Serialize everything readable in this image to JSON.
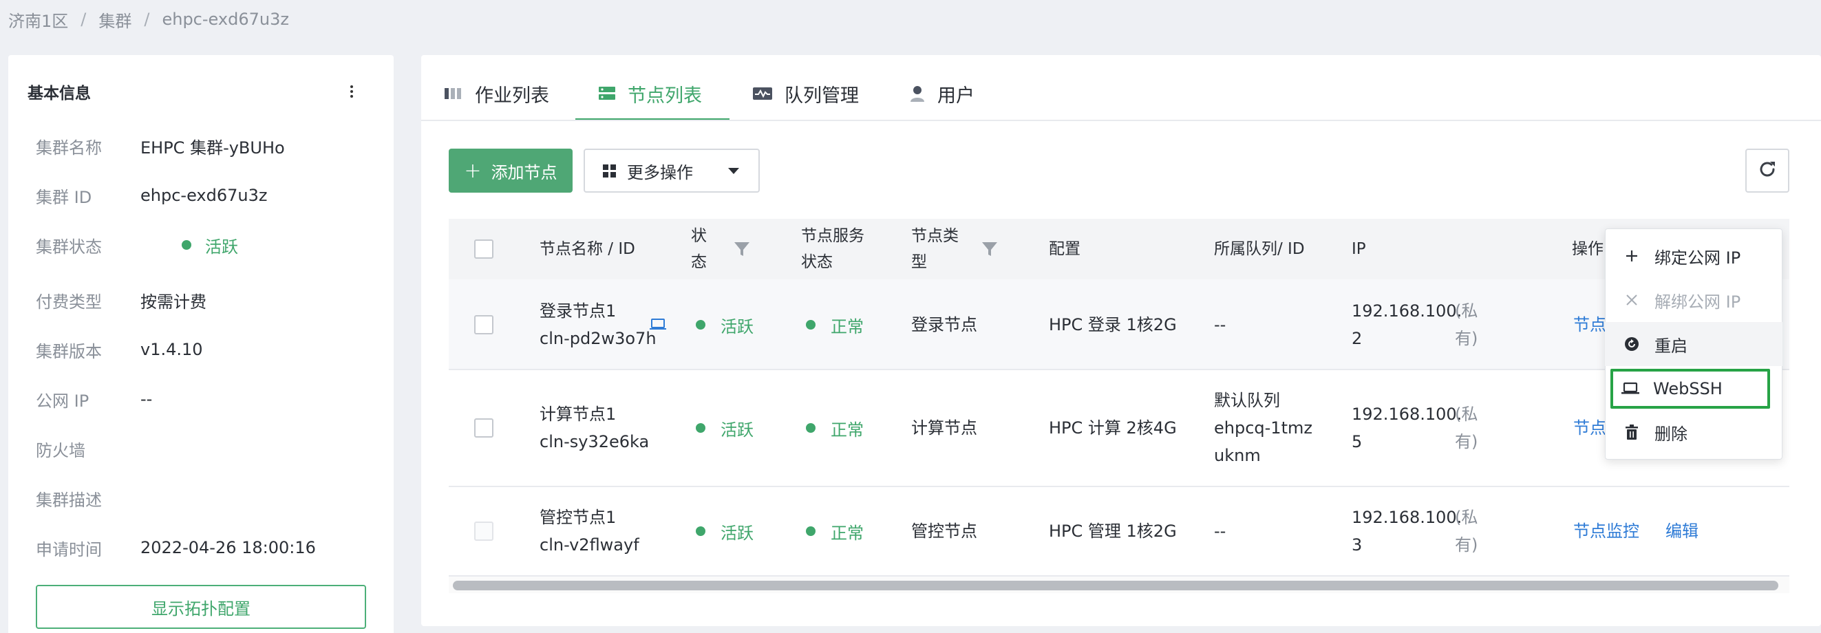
{
  "breadcrumb": [
    "济南1区",
    "集群",
    "ehpc-exd67u3z"
  ],
  "left_panel": {
    "title": "基本信息",
    "rows": [
      {
        "label": "集群名称",
        "value": "EHPC 集群-yBUHo"
      },
      {
        "label": "集群 ID",
        "value": "ehpc-exd67u3z"
      },
      {
        "label": "集群状态",
        "value": "活跃"
      },
      {
        "label": "付费类型",
        "value": "按需计费"
      },
      {
        "label": "集群版本",
        "value": "v1.4.10"
      },
      {
        "label": "公网 IP",
        "value": "--"
      },
      {
        "label": "防火墙",
        "value": ""
      },
      {
        "label": "集群描述",
        "value": ""
      },
      {
        "label": "申请时间",
        "value": "2022-04-26 18:00:16"
      }
    ],
    "topology_button": "显示拓扑配置"
  },
  "tabs": [
    {
      "label": "作业列表",
      "icon": "bars-icon"
    },
    {
      "label": "节点列表",
      "icon": "server-icon"
    },
    {
      "label": "队列管理",
      "icon": "activity-icon"
    },
    {
      "label": "用户",
      "icon": "user-icon"
    }
  ],
  "active_tab": "节点列表",
  "toolbar": {
    "add_label": "添加节点",
    "more_label": "更多操作"
  },
  "table": {
    "headers": {
      "name": "节点名称 / ID",
      "status_1": "状",
      "status_2": "态",
      "service_1": "节点服务",
      "service_2": "状态",
      "type_1": "节点类",
      "type_2": "型",
      "config": "配置",
      "queue": "所属队列/ ID",
      "ip": "IP",
      "ops": "操作"
    },
    "rows": [
      {
        "name": "登录节点1",
        "id": "cln-pd2w3o7h",
        "status": "活跃",
        "service": "正常",
        "type": "登录节点",
        "config": "HPC 登录 1核2G",
        "queue_1": "--",
        "queue_2": "",
        "queue_3": "",
        "ip_1": "192.168.100.",
        "ip_2": "2",
        "ip_tag_1": "(私",
        "ip_tag_2": "有)",
        "op_1": "节点监控"
      },
      {
        "name": "计算节点1",
        "id": "cln-sy32e6ka",
        "status": "活跃",
        "service": "正常",
        "type": "计算节点",
        "config": "HPC 计算 2核4G",
        "queue_1": "默认队列",
        "queue_2": "ehpcq-1tmz",
        "queue_3": "uknm",
        "ip_1": "192.168.100.",
        "ip_2": "5",
        "ip_tag_1": "(私",
        "ip_tag_2": "有)",
        "op_1": "节点监控"
      },
      {
        "name": "管控节点1",
        "id": "cln-v2flwayf",
        "status": "活跃",
        "service": "正常",
        "type": "管控节点",
        "config": "HPC 管理 1核2G",
        "queue_1": "--",
        "queue_2": "",
        "queue_3": "",
        "ip_1": "192.168.100.",
        "ip_2": "3",
        "ip_tag_1": "(私",
        "ip_tag_2": "有)",
        "op_1": "节点监控",
        "op_2": "编辑"
      }
    ]
  },
  "dropdown_menu": [
    {
      "label": "绑定公网 IP",
      "icon": "plus-icon",
      "disabled": false
    },
    {
      "label": "解绑公网 IP",
      "icon": "close-icon",
      "disabled": true
    },
    {
      "label": "重启",
      "icon": "restart-icon",
      "disabled": false
    },
    {
      "label": "WebSSH",
      "icon": "laptop-icon",
      "disabled": false
    },
    {
      "label": "删除",
      "icon": "trash-icon",
      "disabled": false
    }
  ],
  "colors": {
    "accent": "#3fa66b",
    "link": "#2e7bd6",
    "focus_outline": "#27a346"
  }
}
